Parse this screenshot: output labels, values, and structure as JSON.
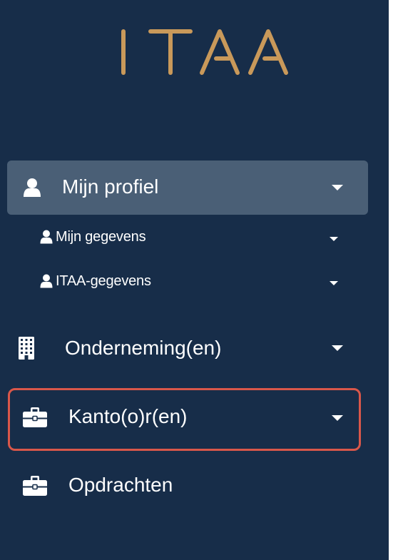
{
  "brand": {
    "logo_text": "ITAA",
    "logo_color": "#c9995a"
  },
  "colors": {
    "sidebar_bg": "#172d49",
    "active_bg": "#4a5f76",
    "highlight_border": "#d9574a",
    "text": "#ffffff"
  },
  "nav": {
    "profile": {
      "label": "Mijn profiel",
      "icon": "user-icon",
      "expanded": true
    },
    "profile_sub": [
      {
        "label": "Mijn gegevens",
        "icon": "user-icon"
      },
      {
        "label": "ITAA-gegevens",
        "icon": "user-icon"
      }
    ],
    "companies": {
      "label": "Onderneming(en)",
      "icon": "building-icon"
    },
    "offices": {
      "label": "Kanto(o)r(en)",
      "icon": "briefcase-icon",
      "highlighted": true
    },
    "assignments": {
      "label": "Opdrachten",
      "icon": "briefcase-icon"
    }
  }
}
